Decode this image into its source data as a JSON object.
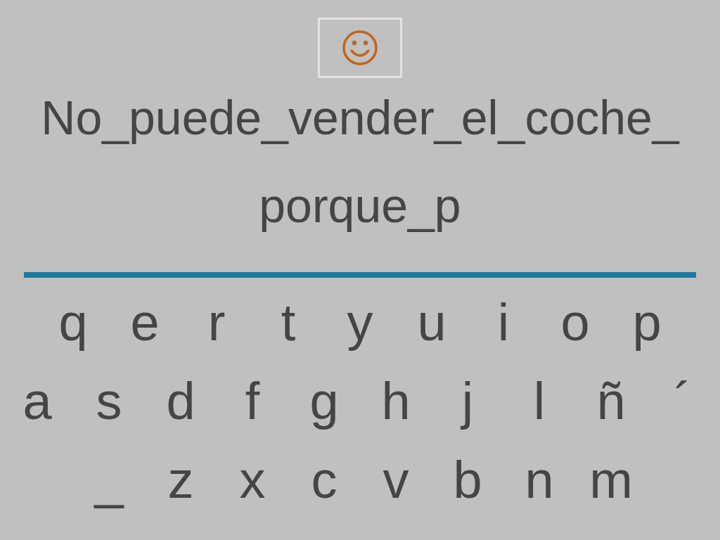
{
  "phrase_lines": [
    "No_puede_vender_el_coche_",
    "porque_p"
  ],
  "keyboard": {
    "rows": [
      [
        "q",
        "e",
        "r",
        "t",
        "y",
        "u",
        "i",
        "o",
        "p"
      ],
      [
        "a",
        "s",
        "d",
        "f",
        "g",
        "h",
        "j",
        "l",
        "ñ",
        "´"
      ],
      [
        "_",
        "z",
        "x",
        "c",
        "v",
        "b",
        "n",
        "m"
      ]
    ]
  }
}
